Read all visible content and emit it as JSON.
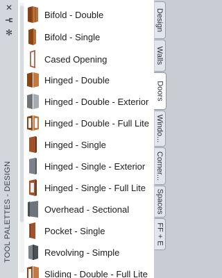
{
  "palette": {
    "title": "TOOL PALETTES - DESIGN",
    "strip_icons": [
      "close-icon",
      "auto-hide-icon",
      "properties-icon"
    ]
  },
  "items": [
    {
      "label": "Bifold - Double",
      "icon": "bifold-double-door-icon"
    },
    {
      "label": "Bifold - Single",
      "icon": "bifold-single-door-icon"
    },
    {
      "label": "Cased Opening",
      "icon": "cased-opening-icon"
    },
    {
      "label": "Hinged - Double",
      "icon": "hinged-double-door-icon"
    },
    {
      "label": "Hinged - Double - Exterior",
      "icon": "hinged-double-exterior-door-icon"
    },
    {
      "label": "Hinged - Double - Full Lite",
      "icon": "hinged-double-full-lite-door-icon"
    },
    {
      "label": "Hinged - Single",
      "icon": "hinged-single-door-icon"
    },
    {
      "label": "Hinged - Single - Exterior",
      "icon": "hinged-single-exterior-door-icon"
    },
    {
      "label": "Hinged - Single - Full Lite",
      "icon": "hinged-single-full-lite-door-icon"
    },
    {
      "label": "Overhead - Sectional",
      "icon": "overhead-sectional-door-icon"
    },
    {
      "label": "Pocket - Single",
      "icon": "pocket-single-door-icon"
    },
    {
      "label": "Revolving - Simple",
      "icon": "revolving-door-icon"
    },
    {
      "label": "Sliding - Double - Full Lite",
      "icon": "sliding-double-full-lite-door-icon"
    }
  ],
  "tabs": [
    {
      "label": "Design",
      "active": false
    },
    {
      "label": "Walls",
      "active": false
    },
    {
      "label": "Doors",
      "active": true
    },
    {
      "label": "Windo...",
      "active": false
    },
    {
      "label": "Corner...",
      "active": false
    },
    {
      "label": "Spaces",
      "active": false
    },
    {
      "label": "FF + E",
      "active": false
    }
  ],
  "colors": {
    "door_wood": "#a0522d",
    "door_grey": "#8a8f95"
  }
}
